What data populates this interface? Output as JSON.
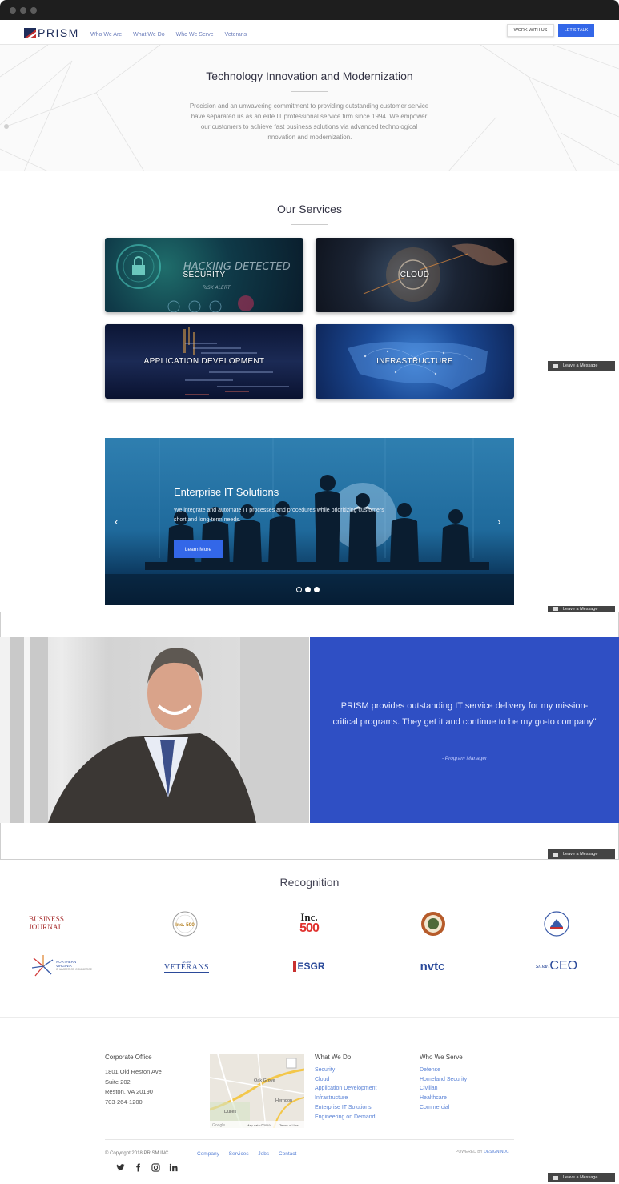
{
  "nav": {
    "brand": "PRISM",
    "links": [
      "Who We Are",
      "What We Do",
      "Who We Serve",
      "Veterans"
    ],
    "work_button": "WORK WITH US",
    "talk_button": "LET'S TALK"
  },
  "hero": {
    "title": "Technology Innovation and Modernization",
    "text": "Precision and an unwavering commitment to providing outstanding customer service have separated us as an elite IT professional service firm since 1994. We empower our customers to achieve fast business solutions via advanced technological innovation and modernization."
  },
  "services": {
    "title": "Our Services",
    "cards": [
      "SECURITY",
      "CLOUD",
      "APPLICATION DEVELOPMENT",
      "INFRASTRUCTURE"
    ],
    "security_overlay": "HACKING DETECTED",
    "security_overlay_sub": "RISK ALERT"
  },
  "chat": {
    "label": "Leave a Message"
  },
  "carousel": {
    "title": "Enterprise IT Solutions",
    "text": "We integrate and automate IT processes and procedures while prioritizing customers short and long-term needs.",
    "button": "Learn More",
    "prev": "‹",
    "next": "›",
    "slide_count": 3,
    "active_index": 0
  },
  "testimonial": {
    "quote": "PRISM provides outstanding IT service delivery for my mission-critical programs. They get it and continue to be my go-to company\"",
    "by": "- Program Manager"
  },
  "recognition": {
    "title": "Recognition",
    "logos": {
      "wbj": "BUSINESS JOURNAL",
      "inc500_badge": "Inc. 500",
      "inc": "Inc.",
      "inc_num": "500",
      "nova": "NORTHERN VIRGINIA",
      "nova_sub": "CHAMBER OF COMMERCE",
      "veterans": "VETERANS",
      "veterans_sub": "NOVA",
      "esgr": "ESGR",
      "nvtc": "nvtc",
      "smart": "smart",
      "ceo": "CEO"
    }
  },
  "footer": {
    "office_heading": "Corporate Office",
    "address": [
      "1801 Old Reston Ave",
      "Suite 202",
      "Reston, VA 20190",
      "703-264-1200"
    ],
    "what_heading": "What We Do",
    "what_links": [
      "Security",
      "Cloud",
      "Application Development",
      "Infrastructure",
      "Enterprise IT Solutions",
      "Engineering on Demand"
    ],
    "serve_heading": "Who We Serve",
    "serve_links": [
      "Defense",
      "Homeland Security",
      "Civilian",
      "Healthcare",
      "Commercial"
    ],
    "map": {
      "label_oak": "Oak Grove",
      "label_herndon": "Herndon",
      "label_dulles": "Dulles",
      "data": "Map data ©2019",
      "terms": "Terms of Use",
      "google": "Google"
    },
    "copyright": "© Copyright 2018 PRISM INC.",
    "bottom_links": [
      "Company",
      "Services",
      "Jobs",
      "Contact"
    ],
    "powered_prefix": "POWERED BY",
    "powered_by": "DESIGNINDC"
  },
  "colors": {
    "accent": "#3367e8",
    "testimonial_bg": "#2f4fc4",
    "link": "#5b83d6"
  }
}
